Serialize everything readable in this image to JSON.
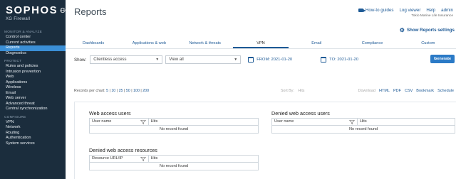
{
  "brand": {
    "name": "SOPHOS",
    "product": "XG Firewall"
  },
  "sidebar": {
    "sections": [
      {
        "heading": "MONITOR & ANALYZE",
        "items": [
          {
            "label": "Control center",
            "active": false
          },
          {
            "label": "Current activities",
            "active": false
          },
          {
            "label": "Reports",
            "active": true
          },
          {
            "label": "Diagnostics",
            "active": false
          }
        ]
      },
      {
        "heading": "PROTECT",
        "items": [
          {
            "label": "Rules and policies",
            "active": false
          },
          {
            "label": "Intrusion prevention",
            "active": false
          },
          {
            "label": "Web",
            "active": false
          },
          {
            "label": "Applications",
            "active": false
          },
          {
            "label": "Wireless",
            "active": false
          },
          {
            "label": "Email",
            "active": false
          },
          {
            "label": "Web server",
            "active": false
          },
          {
            "label": "Advanced threat",
            "active": false
          },
          {
            "label": "Central synchronization",
            "active": false
          }
        ]
      },
      {
        "heading": "CONFIGURE",
        "items": [
          {
            "label": "VPN",
            "active": false
          },
          {
            "label": "Network",
            "active": false
          },
          {
            "label": "Routing",
            "active": false
          },
          {
            "label": "Authentication",
            "active": false
          },
          {
            "label": "System services",
            "active": false
          }
        ]
      }
    ]
  },
  "header": {
    "title": "Reports",
    "links": {
      "guides": "How-to guides",
      "log_viewer": "Log viewer",
      "help": "Help",
      "user": "admin"
    },
    "company": "Tokio Marine Life Insurance",
    "settings": "Show Reports settings"
  },
  "tabs": [
    {
      "label": "Dashboards",
      "active": false
    },
    {
      "label": "Applications & web",
      "active": false
    },
    {
      "label": "Network & threats",
      "active": false
    },
    {
      "label": "VPN",
      "active": true
    },
    {
      "label": "Email",
      "active": false
    },
    {
      "label": "Compliance",
      "active": false
    },
    {
      "label": "Custom",
      "active": false
    }
  ],
  "filters": {
    "show_label": "Show:",
    "access_select": "Clientless access",
    "view_select": "View all",
    "from": "FROM: 2021-01-20",
    "to": "TO: 2021-01-20",
    "generate": "Generate"
  },
  "records": {
    "label": "Records per chart:",
    "options": [
      "5",
      "10",
      "25",
      "50",
      "100",
      "200"
    ]
  },
  "sort": {
    "label": "Sort By:",
    "value": "Hits"
  },
  "exports": {
    "download": "Download",
    "items": [
      "HTML",
      "PDF",
      "CSV",
      "Bookmark",
      "Schedule"
    ]
  },
  "widgets": {
    "web_access": {
      "title": "Web access users",
      "col1": "User name",
      "col2": "Hits",
      "empty": "No record found"
    },
    "denied_web_access": {
      "title": "Denied web access users",
      "col1": "User name",
      "col2": "Hits",
      "empty": "No record found"
    },
    "denied_resources": {
      "title": "Denied web access resources",
      "col1": "Resource URL/IP",
      "col2": "Hits",
      "empty": "No record found"
    }
  }
}
